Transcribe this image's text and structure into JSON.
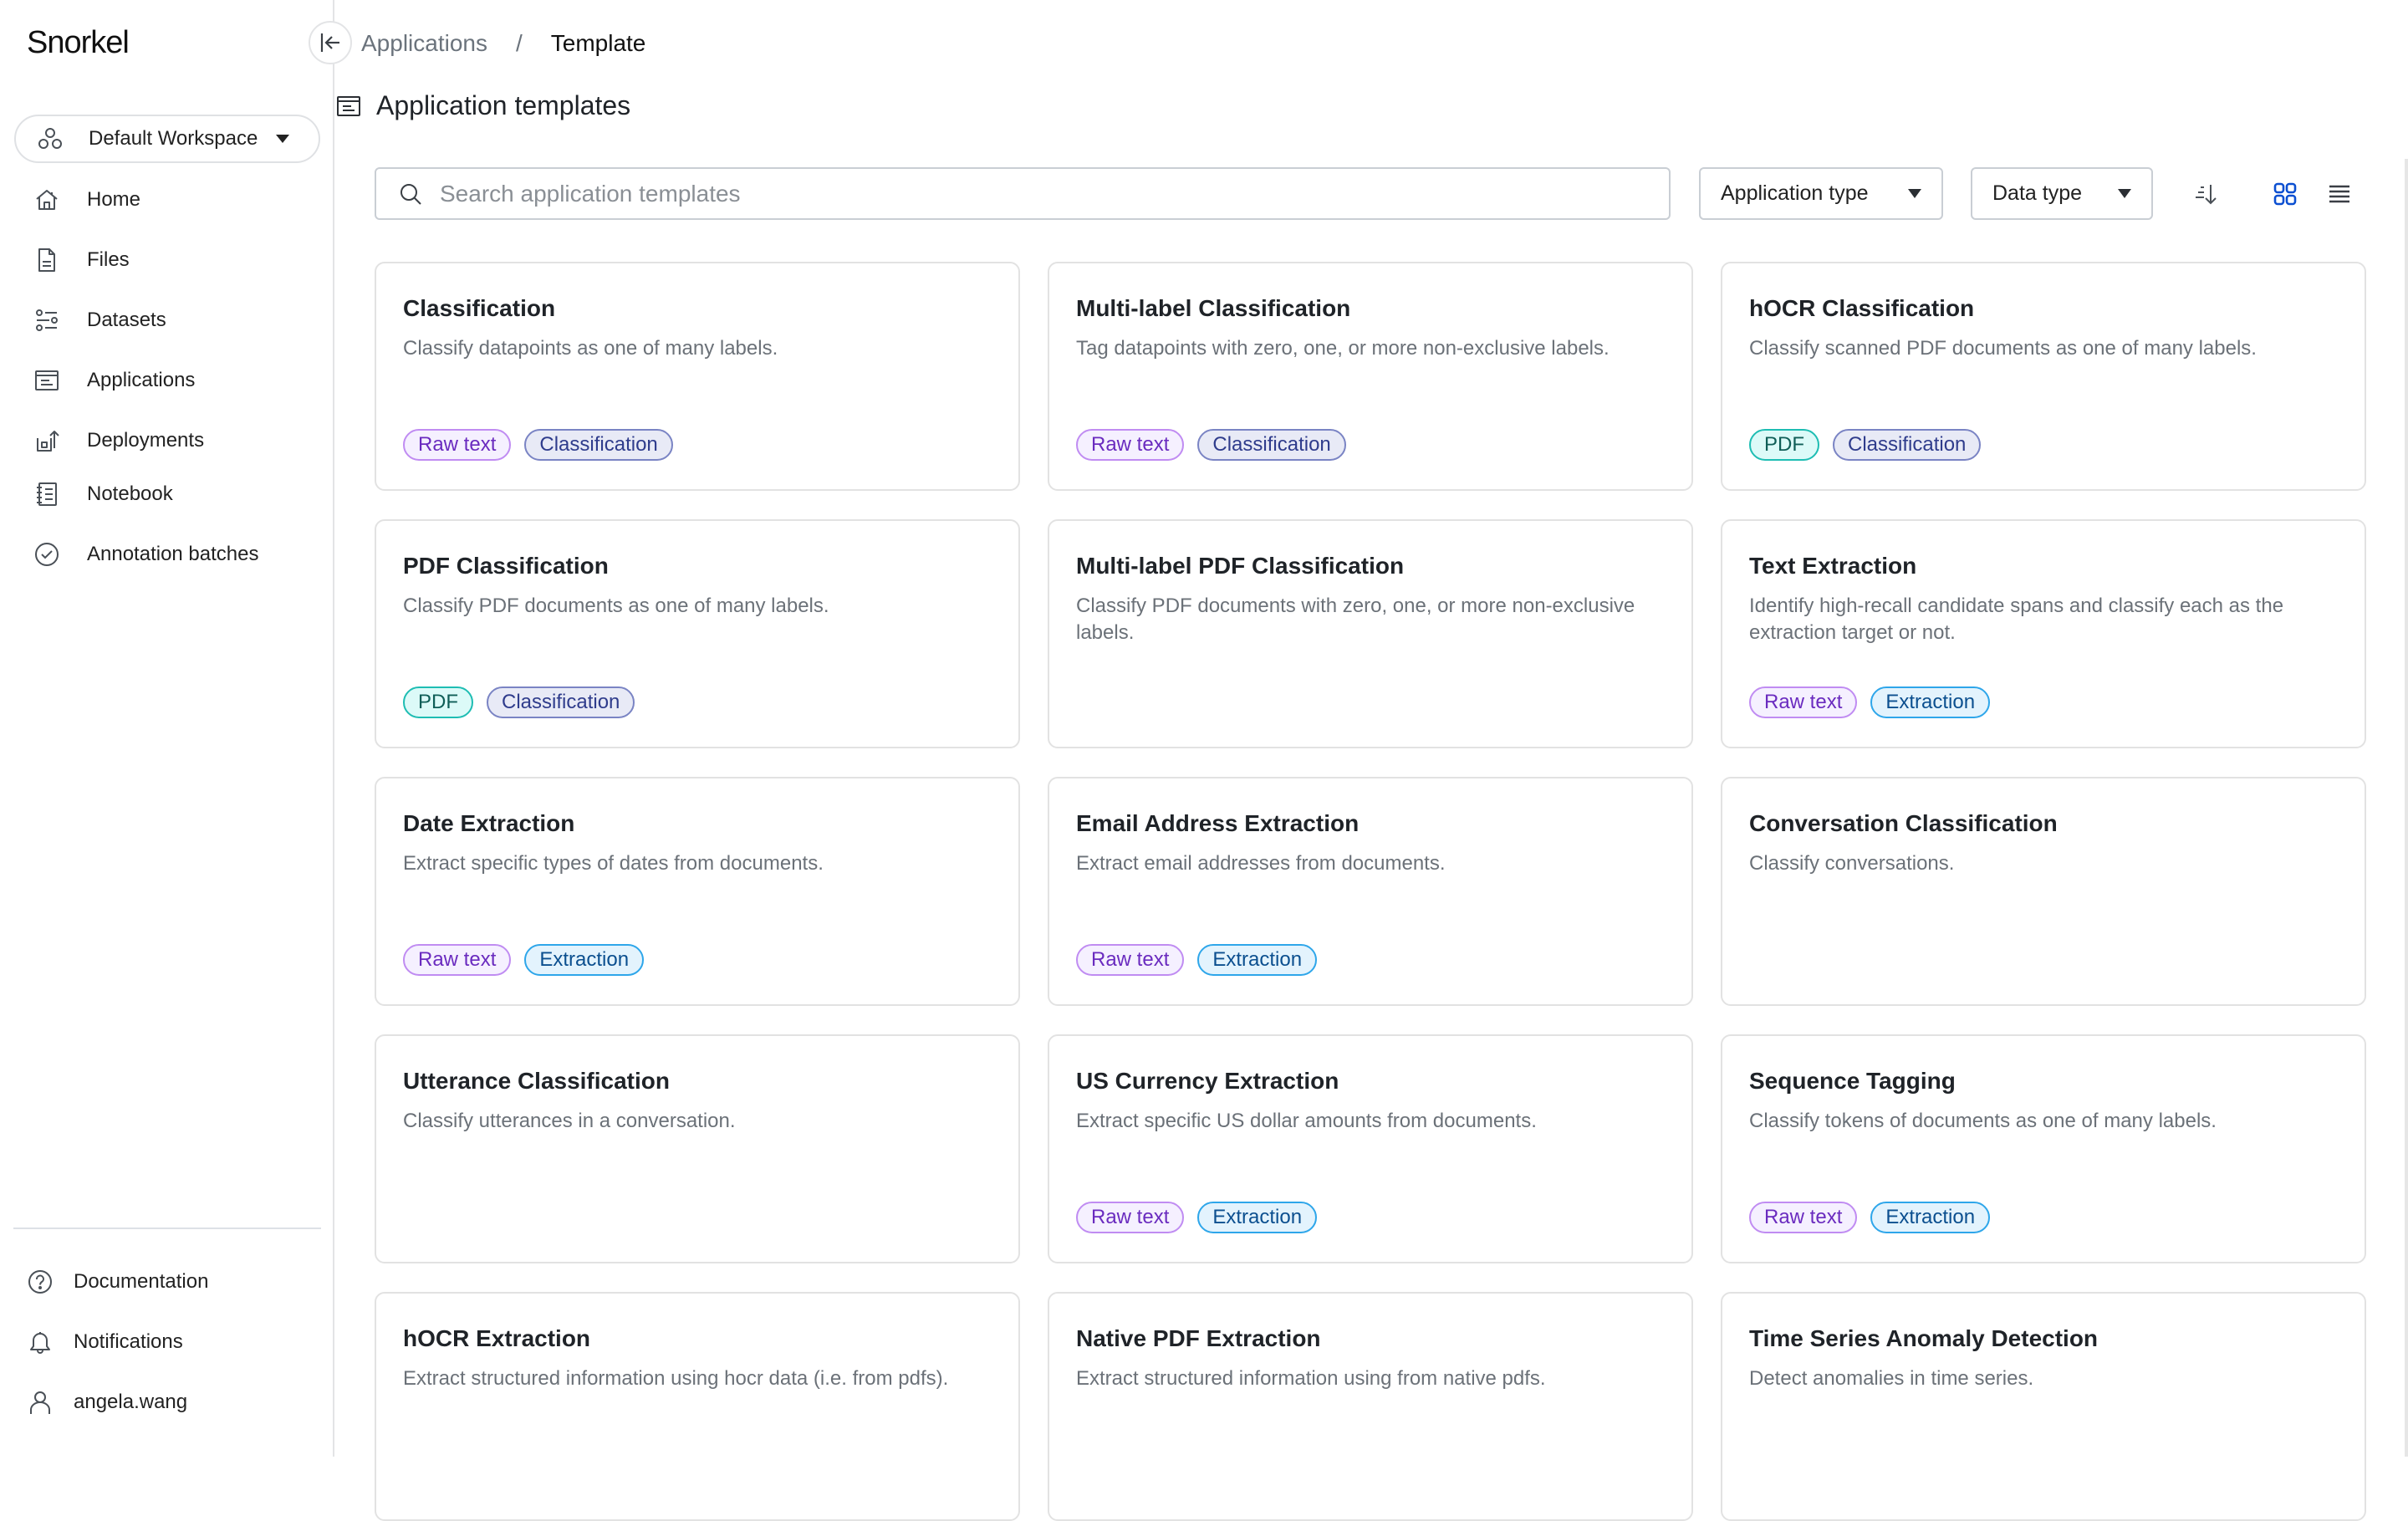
{
  "sidebar": {
    "logo": "Snorkel",
    "workspace": {
      "label": "Default Workspace",
      "icon": "workspace-icon"
    },
    "nav": [
      {
        "label": "Home",
        "icon": "home-icon"
      },
      {
        "label": "Files",
        "icon": "file-icon"
      },
      {
        "label": "Datasets",
        "icon": "datasets-icon"
      },
      {
        "label": "Applications",
        "icon": "applications-icon"
      },
      {
        "label": "Deployments",
        "icon": "deployments-icon"
      },
      {
        "label": "Notebook",
        "icon": "notebook-icon"
      },
      {
        "label": "Annotation batches",
        "icon": "check-circle-icon"
      }
    ],
    "bottom": [
      {
        "label": "Documentation",
        "icon": "help-icon"
      },
      {
        "label": "Notifications",
        "icon": "bell-icon"
      },
      {
        "label": "angela.wang",
        "icon": "user-icon"
      }
    ]
  },
  "breadcrumb": {
    "parent": "Applications",
    "separator": "/",
    "current": "Template"
  },
  "page": {
    "title": "Application templates"
  },
  "toolbar": {
    "search_placeholder": "Search application templates",
    "search_value": "",
    "application_type": "Application type",
    "data_type": "Data type",
    "view_mode": "grid",
    "accent_color": "#0b4fd1"
  },
  "tag_styles": {
    "Raw text": "raw",
    "Classification": "cls",
    "PDF": "pdf",
    "Extraction": "ext"
  },
  "templates": [
    {
      "title": "Classification",
      "description": "Classify datapoints as one of many labels.",
      "tags": [
        "Raw text",
        "Classification"
      ]
    },
    {
      "title": "Multi-label Classification",
      "description": "Tag datapoints with zero, one, or more non-exclusive labels.",
      "tags": [
        "Raw text",
        "Classification"
      ]
    },
    {
      "title": "hOCR Classification",
      "description": "Classify scanned PDF documents as one of many labels.",
      "tags": [
        "PDF",
        "Classification"
      ]
    },
    {
      "title": "PDF Classification",
      "description": "Classify PDF documents as one of many labels.",
      "tags": [
        "PDF",
        "Classification"
      ]
    },
    {
      "title": "Multi-label PDF Classification",
      "description": "Classify PDF documents with zero, one, or more non-exclusive labels.",
      "tags": []
    },
    {
      "title": "Text Extraction",
      "description": "Identify high-recall candidate spans and classify each as the extraction target or not.",
      "tags": [
        "Raw text",
        "Extraction"
      ]
    },
    {
      "title": "Date Extraction",
      "description": "Extract specific types of dates from documents.",
      "tags": [
        "Raw text",
        "Extraction"
      ]
    },
    {
      "title": "Email Address Extraction",
      "description": "Extract email addresses from documents.",
      "tags": [
        "Raw text",
        "Extraction"
      ]
    },
    {
      "title": "Conversation Classification",
      "description": "Classify conversations.",
      "tags": []
    },
    {
      "title": "Utterance Classification",
      "description": "Classify utterances in a conversation.",
      "tags": []
    },
    {
      "title": "US Currency Extraction",
      "description": "Extract specific US dollar amounts from documents.",
      "tags": [
        "Raw text",
        "Extraction"
      ]
    },
    {
      "title": "Sequence Tagging",
      "description": "Classify tokens of documents as one of many labels.",
      "tags": [
        "Raw text",
        "Extraction"
      ]
    },
    {
      "title": "hOCR Extraction",
      "description": "Extract structured information using hocr data (i.e. from pdfs).",
      "tags": []
    },
    {
      "title": "Native PDF Extraction",
      "description": "Extract structured information using from native pdfs.",
      "tags": []
    },
    {
      "title": "Time Series Anomaly Detection",
      "description": "Detect anomalies in time series.",
      "tags": []
    }
  ]
}
